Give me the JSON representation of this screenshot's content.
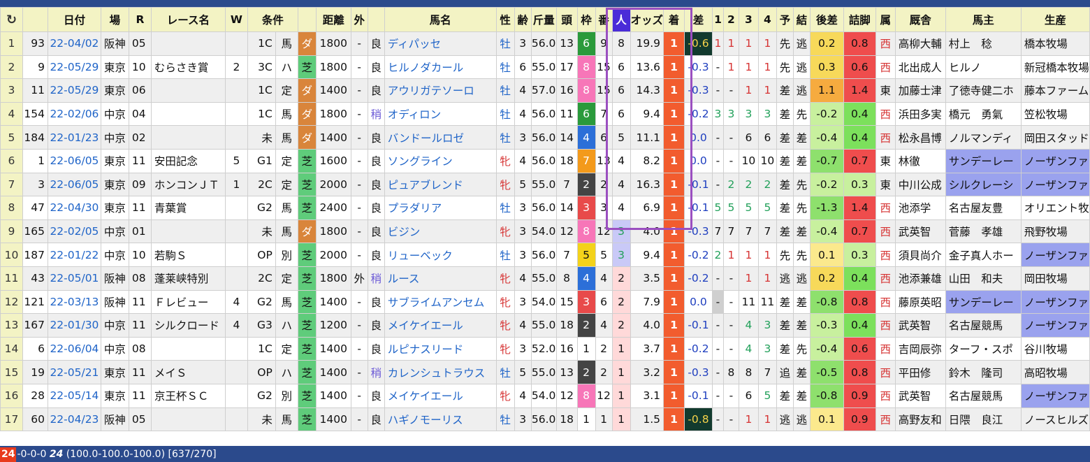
{
  "headers": [
    "↻",
    "日付",
    "場",
    "R",
    "レース名",
    "W",
    "条件",
    "",
    "距離",
    "外",
    "",
    "馬名",
    "性",
    "齢",
    "斤量",
    "頭",
    "枠",
    "番",
    "人",
    "オッズ",
    "着",
    "差",
    "1",
    "2",
    "3",
    "4",
    "予",
    "結",
    "後差",
    "詰脚",
    "属",
    "厩舎",
    "馬主",
    "生産"
  ],
  "rows": [
    {
      "idx": "1",
      "n": "93",
      "date": "22-04/02",
      "jo": "阪神",
      "r": "05",
      "race": "",
      "w": "",
      "grade": "1C",
      "cond": "馬",
      "sf": "ダ",
      "dist": "1800",
      "out": "-",
      "track": "良",
      "horse": "ディパッセ",
      "sex": "牡",
      "age": "3",
      "kin": "56.0",
      "heads": "13",
      "waku": "6",
      "ban": "9",
      "pop": "8",
      "odds": "19.9",
      "fin": "1",
      "diff": "-0.6",
      "c1": "1",
      "c2": "1",
      "c3": "1",
      "c4": "1",
      "yo": "先",
      "ke": "逃",
      "agari": "0.2",
      "tsume": "0.8",
      "zoku": "西",
      "trainer": "高柳大輔",
      "owner": "村上　稔",
      "breeder": "橋本牧場"
    },
    {
      "idx": "2",
      "n": "9",
      "date": "22-05/29",
      "jo": "東京",
      "r": "10",
      "race": "むらさき賞",
      "w": "2",
      "grade": "3C",
      "cond": "ハ",
      "sf": "芝",
      "dist": "1800",
      "out": "-",
      "track": "良",
      "horse": "ヒルノダカール",
      "sex": "牡",
      "age": "6",
      "kin": "55.0",
      "heads": "17",
      "waku": "8",
      "ban": "15",
      "pop": "6",
      "odds": "13.6",
      "fin": "1",
      "diff": "-0.3",
      "c1": "-",
      "c2": "1",
      "c3": "1",
      "c4": "1",
      "yo": "先",
      "ke": "逃",
      "agari": "0.3",
      "tsume": "0.6",
      "zoku": "西",
      "trainer": "北出成人",
      "owner": "ヒルノ",
      "breeder": "新冠橋本牧場"
    },
    {
      "idx": "3",
      "n": "11",
      "date": "22-05/29",
      "jo": "東京",
      "r": "06",
      "race": "",
      "w": "",
      "grade": "1C",
      "cond": "定",
      "sf": "ダ",
      "dist": "1400",
      "out": "-",
      "track": "良",
      "horse": "アウリガテソーロ",
      "sex": "牡",
      "age": "4",
      "kin": "57.0",
      "heads": "16",
      "waku": "8",
      "ban": "15",
      "pop": "6",
      "odds": "14.3",
      "fin": "1",
      "diff": "-0.3",
      "c1": "-",
      "c2": "-",
      "c3": "1",
      "c4": "1",
      "yo": "差",
      "ke": "逃",
      "agari": "1.1",
      "tsume": "1.4",
      "zoku": "東",
      "trainer": "加藤士津",
      "owner": "了徳寺健二ホ",
      "breeder": "藤本ファーム"
    },
    {
      "idx": "4",
      "n": "154",
      "date": "22-02/06",
      "jo": "中京",
      "r": "04",
      "race": "",
      "w": "",
      "grade": "1C",
      "cond": "馬",
      "sf": "ダ",
      "dist": "1800",
      "out": "-",
      "track": "稍",
      "horse": "オディロン",
      "sex": "牡",
      "age": "4",
      "kin": "56.0",
      "heads": "11",
      "waku": "6",
      "ban": "7",
      "pop": "6",
      "odds": "9.4",
      "fin": "1",
      "diff": "-0.2",
      "c1": "3",
      "c2": "3",
      "c3": "3",
      "c4": "3",
      "yo": "差",
      "ke": "先",
      "agari": "-0.2",
      "tsume": "0.4",
      "zoku": "西",
      "trainer": "浜田多実",
      "owner": "橋元　勇氣",
      "breeder": "笠松牧場"
    },
    {
      "idx": "5",
      "n": "184",
      "date": "22-01/23",
      "jo": "中京",
      "r": "02",
      "race": "",
      "w": "",
      "grade": "未",
      "cond": "馬",
      "sf": "ダ",
      "dist": "1400",
      "out": "-",
      "track": "良",
      "horse": "バンドールロゼ",
      "sex": "牡",
      "age": "3",
      "kin": "56.0",
      "heads": "14",
      "waku": "4",
      "ban": "6",
      "pop": "5",
      "odds": "11.1",
      "fin": "1",
      "diff": "0.0",
      "c1": "-",
      "c2": "-",
      "c3": "6",
      "c4": "6",
      "yo": "差",
      "ke": "差",
      "agari": "-0.4",
      "tsume": "0.4",
      "zoku": "西",
      "trainer": "松永昌博",
      "owner": "ノルマンディ",
      "breeder": "岡田スタッド"
    },
    {
      "idx": "6",
      "n": "1",
      "date": "22-06/05",
      "jo": "東京",
      "r": "11",
      "race": "安田記念",
      "w": "5",
      "grade": "G1",
      "cond": "定",
      "sf": "芝",
      "dist": "1600",
      "out": "-",
      "track": "良",
      "horse": "ソングライン",
      "sex": "牝",
      "age": "4",
      "kin": "56.0",
      "heads": "18",
      "waku": "7",
      "ban": "13",
      "pop": "4",
      "odds": "8.2",
      "fin": "1",
      "diff": "0.0",
      "c1": "-",
      "c2": "-",
      "c3": "10",
      "c4": "10",
      "yo": "差",
      "ke": "差",
      "agari": "-0.7",
      "tsume": "0.7",
      "zoku": "東",
      "trainer": "林徹",
      "owner": "サンデーレー",
      "breeder": "ノーザンファ"
    },
    {
      "idx": "7",
      "n": "3",
      "date": "22-06/05",
      "jo": "東京",
      "r": "09",
      "race": "ホンコンＪＴ",
      "w": "1",
      "grade": "2C",
      "cond": "定",
      "sf": "芝",
      "dist": "2000",
      "out": "-",
      "track": "良",
      "horse": "ピュアブレンド",
      "sex": "牝",
      "age": "5",
      "kin": "55.0",
      "heads": "7",
      "waku": "2",
      "ban": "2",
      "pop": "4",
      "odds": "16.3",
      "fin": "1",
      "diff": "-0.1",
      "c1": "-",
      "c2": "2",
      "c3": "2",
      "c4": "2",
      "yo": "差",
      "ke": "先",
      "agari": "-0.2",
      "tsume": "0.3",
      "zoku": "東",
      "trainer": "中川公成",
      "owner": "シルクレーシ",
      "breeder": "ノーザンファ"
    },
    {
      "idx": "8",
      "n": "47",
      "date": "22-04/30",
      "jo": "東京",
      "r": "11",
      "race": "青葉賞",
      "w": "",
      "grade": "G2",
      "cond": "馬",
      "sf": "芝",
      "dist": "2400",
      "out": "-",
      "track": "良",
      "horse": "プラダリア",
      "sex": "牡",
      "age": "3",
      "kin": "56.0",
      "heads": "14",
      "waku": "3",
      "ban": "3",
      "pop": "4",
      "odds": "6.9",
      "fin": "1",
      "diff": "-0.1",
      "c1": "5",
      "c2": "5",
      "c3": "5",
      "c4": "5",
      "yo": "差",
      "ke": "先",
      "agari": "-1.3",
      "tsume": "1.4",
      "zoku": "西",
      "trainer": "池添学",
      "owner": "名古屋友豊",
      "breeder": "オリエント牧"
    },
    {
      "idx": "9",
      "n": "165",
      "date": "22-02/05",
      "jo": "中京",
      "r": "01",
      "race": "",
      "w": "",
      "grade": "未",
      "cond": "馬",
      "sf": "ダ",
      "dist": "1800",
      "out": "-",
      "track": "良",
      "horse": "ビジン",
      "sex": "牝",
      "age": "3",
      "kin": "54.0",
      "heads": "12",
      "waku": "8",
      "ban": "12",
      "pop": "3",
      "odds": "4.0",
      "fin": "1",
      "diff": "-0.3",
      "c1": "7",
      "c2": "7",
      "c3": "7",
      "c4": "7",
      "yo": "差",
      "ke": "差",
      "agari": "-0.4",
      "tsume": "0.7",
      "zoku": "西",
      "trainer": "武英智",
      "owner": "菅藤　孝雄",
      "breeder": "飛野牧場"
    },
    {
      "idx": "10",
      "n": "187",
      "date": "22-01/22",
      "jo": "中京",
      "r": "10",
      "race": "若駒Ｓ",
      "w": "",
      "grade": "OP",
      "cond": "別",
      "sf": "芝",
      "dist": "2000",
      "out": "-",
      "track": "良",
      "horse": "リューベック",
      "sex": "牡",
      "age": "3",
      "kin": "56.0",
      "heads": "7",
      "waku": "5",
      "ban": "5",
      "pop": "3",
      "odds": "9.4",
      "fin": "1",
      "diff": "-0.2",
      "c1": "2",
      "c2": "1",
      "c3": "1",
      "c4": "1",
      "yo": "先",
      "ke": "先",
      "agari": "0.1",
      "tsume": "0.3",
      "zoku": "西",
      "trainer": "須貝尚介",
      "owner": "金子真人ホー",
      "breeder": "ノーザンファ"
    },
    {
      "idx": "11",
      "n": "43",
      "date": "22-05/01",
      "jo": "阪神",
      "r": "08",
      "race": "蓬莱峡特別",
      "w": "",
      "grade": "2C",
      "cond": "定",
      "sf": "芝",
      "dist": "1800",
      "out": "外",
      "track": "稍",
      "horse": "ルース",
      "sex": "牝",
      "age": "4",
      "kin": "55.0",
      "heads": "8",
      "waku": "4",
      "ban": "4",
      "pop": "2",
      "odds": "3.5",
      "fin": "1",
      "diff": "-0.2",
      "c1": "-",
      "c2": "-",
      "c3": "1",
      "c4": "1",
      "yo": "逃",
      "ke": "逃",
      "agari": "0.2",
      "tsume": "0.4",
      "zoku": "西",
      "trainer": "池添兼雄",
      "owner": "山田　和夫",
      "breeder": "岡田牧場"
    },
    {
      "idx": "12",
      "n": "121",
      "date": "22-03/13",
      "jo": "阪神",
      "r": "11",
      "race": "Ｆレビュー",
      "w": "4",
      "grade": "G2",
      "cond": "馬",
      "sf": "芝",
      "dist": "1400",
      "out": "-",
      "track": "良",
      "horse": "サブライムアンセム",
      "sex": "牝",
      "age": "3",
      "kin": "54.0",
      "heads": "15",
      "waku": "3",
      "ban": "6",
      "pop": "2",
      "odds": "7.9",
      "fin": "1",
      "diff": "0.0",
      "c1": "-",
      "c2": "-",
      "c3": "11",
      "c4": "11",
      "yo": "差",
      "ke": "差",
      "agari": "-0.8",
      "tsume": "0.8",
      "zoku": "西",
      "trainer": "藤原英昭",
      "owner": "サンデーレー",
      "breeder": "ノーザンファ"
    },
    {
      "idx": "13",
      "n": "167",
      "date": "22-01/30",
      "jo": "中京",
      "r": "11",
      "race": "シルクロード",
      "w": "4",
      "grade": "G3",
      "cond": "ハ",
      "sf": "芝",
      "dist": "1200",
      "out": "-",
      "track": "良",
      "horse": "メイケイエール",
      "sex": "牝",
      "age": "4",
      "kin": "55.0",
      "heads": "18",
      "waku": "2",
      "ban": "4",
      "pop": "2",
      "odds": "4.0",
      "fin": "1",
      "diff": "-0.1",
      "c1": "-",
      "c2": "-",
      "c3": "4",
      "c4": "3",
      "yo": "差",
      "ke": "差",
      "agari": "-0.3",
      "tsume": "0.4",
      "zoku": "西",
      "trainer": "武英智",
      "owner": "名古屋競馬",
      "breeder": "ノーザンファ"
    },
    {
      "idx": "14",
      "n": "6",
      "date": "22-06/04",
      "jo": "中京",
      "r": "08",
      "race": "",
      "w": "",
      "grade": "1C",
      "cond": "定",
      "sf": "芝",
      "dist": "1400",
      "out": "-",
      "track": "良",
      "horse": "ルピナスリード",
      "sex": "牝",
      "age": "3",
      "kin": "52.0",
      "heads": "16",
      "waku": "1",
      "ban": "2",
      "pop": "1",
      "odds": "3.7",
      "fin": "1",
      "diff": "-0.2",
      "c1": "-",
      "c2": "-",
      "c3": "4",
      "c4": "3",
      "yo": "差",
      "ke": "先",
      "agari": "-0.4",
      "tsume": "0.6",
      "zoku": "西",
      "trainer": "吉岡辰弥",
      "owner": "ターフ・スポ",
      "breeder": "谷川牧場"
    },
    {
      "idx": "15",
      "n": "19",
      "date": "22-05/21",
      "jo": "東京",
      "r": "11",
      "race": "メイＳ",
      "w": "",
      "grade": "OP",
      "cond": "ハ",
      "sf": "芝",
      "dist": "1400",
      "out": "-",
      "track": "稍",
      "horse": "カレンシュトラウス",
      "sex": "牡",
      "age": "5",
      "kin": "55.0",
      "heads": "13",
      "waku": "2",
      "ban": "2",
      "pop": "1",
      "odds": "3.2",
      "fin": "1",
      "diff": "-0.3",
      "c1": "-",
      "c2": "8",
      "c3": "8",
      "c4": "7",
      "yo": "追",
      "ke": "差",
      "agari": "-0.5",
      "tsume": "0.8",
      "zoku": "西",
      "trainer": "平田修",
      "owner": "鈴木　隆司",
      "breeder": "高昭牧場"
    },
    {
      "idx": "16",
      "n": "28",
      "date": "22-05/14",
      "jo": "東京",
      "r": "11",
      "race": "京王杯ＳＣ",
      "w": "",
      "grade": "G2",
      "cond": "別",
      "sf": "芝",
      "dist": "1400",
      "out": "-",
      "track": "良",
      "horse": "メイケイエール",
      "sex": "牝",
      "age": "4",
      "kin": "54.0",
      "heads": "12",
      "waku": "8",
      "ban": "12",
      "pop": "1",
      "odds": "3.1",
      "fin": "1",
      "diff": "-0.1",
      "c1": "-",
      "c2": "-",
      "c3": "6",
      "c4": "5",
      "yo": "差",
      "ke": "差",
      "agari": "-0.8",
      "tsume": "0.9",
      "zoku": "西",
      "trainer": "武英智",
      "owner": "名古屋競馬",
      "breeder": "ノーザンファ"
    },
    {
      "idx": "17",
      "n": "60",
      "date": "22-04/23",
      "jo": "阪神",
      "r": "05",
      "race": "",
      "w": "",
      "grade": "未",
      "cond": "馬",
      "sf": "芝",
      "dist": "1400",
      "out": "-",
      "track": "良",
      "horse": "ハギノモーリス",
      "sex": "牡",
      "age": "3",
      "kin": "56.0",
      "heads": "18",
      "waku": "1",
      "ban": "1",
      "pop": "1",
      "odds": "1.5",
      "fin": "1",
      "diff": "-0.8",
      "c1": "-",
      "c2": "-",
      "c3": "1",
      "c4": "1",
      "yo": "逃",
      "ke": "逃",
      "agari": "0.1",
      "tsume": "0.9",
      "zoku": "西",
      "trainer": "高野友和",
      "owner": "日隈　良江",
      "breeder": "ノースヒルズ"
    }
  ],
  "status": {
    "badge": "24",
    "record": "-0-0-0",
    "count": "24",
    "rates": "(100.0-100.0-100.0)",
    "pages": "[637/270]"
  },
  "colors": {
    "header_bg": "#f3f3c4",
    "selection": "#9b4fc0",
    "finish": "#f25c2e",
    "bar": "#2b4a8c"
  }
}
